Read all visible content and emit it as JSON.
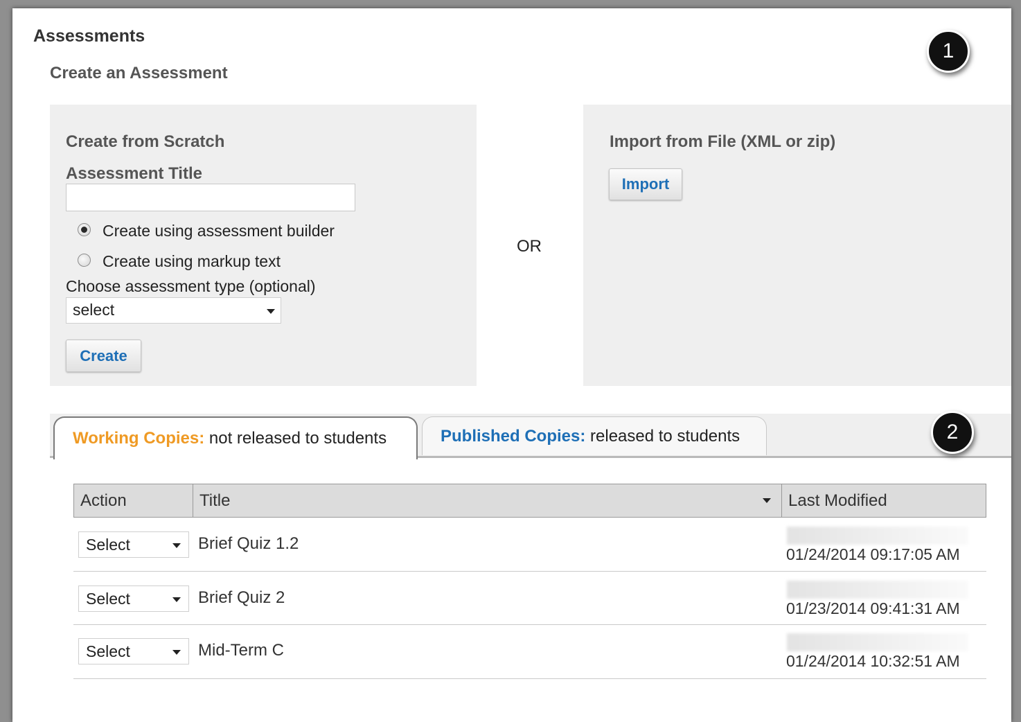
{
  "page": {
    "heading": "Assessments",
    "subheading": "Create an Assessment"
  },
  "scratch": {
    "title": "Create from Scratch",
    "assessment_title_label": "Assessment Title",
    "assessment_title_value": "",
    "radio_builder_label": "Create using assessment builder",
    "radio_markup_label": "Create using markup text",
    "selected_mode": "builder",
    "type_label": "Choose assessment type (optional)",
    "type_value": "select",
    "create_button": "Create"
  },
  "or_label": "OR",
  "import": {
    "title": "Import from File (XML or zip)",
    "import_button": "Import"
  },
  "callouts": [
    "1",
    "2"
  ],
  "tabs": [
    {
      "key": "Working Copies:",
      "rest": " not released to students",
      "active": true,
      "key_color": "#ef9a24"
    },
    {
      "key": "Published Copies:",
      "rest": " released to students",
      "active": false,
      "key_color": "#1e6fb6"
    }
  ],
  "table": {
    "columns": [
      "Action",
      "Title",
      "Last Modified"
    ],
    "rows": [
      {
        "action": "Select",
        "title": "Brief Quiz 1.2",
        "modified": "01/24/2014 09:17:05 AM"
      },
      {
        "action": "Select",
        "title": "Brief Quiz 2",
        "modified": "01/23/2014 09:41:31 AM"
      },
      {
        "action": "Select",
        "title": "Mid-Term C",
        "modified": "01/24/2014 10:32:51 AM"
      }
    ]
  },
  "colors": {
    "accent_blue": "#1e6fb6",
    "accent_orange": "#ef9a24",
    "panel_bg": "#efefef"
  }
}
